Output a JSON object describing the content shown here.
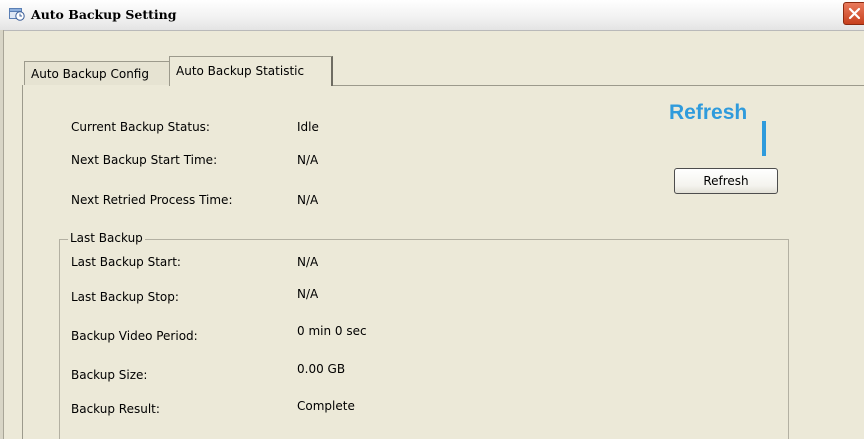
{
  "window": {
    "title": "Auto Backup Setting",
    "icon": "clock-icon"
  },
  "tabs": [
    {
      "label": "Auto Backup Config",
      "active": false
    },
    {
      "label": "Auto Backup Statistic",
      "active": true
    }
  ],
  "status": {
    "current_label": "Current Backup Status:",
    "current_value": "Idle",
    "next_start_label": "Next Backup Start Time:",
    "next_start_value": "N/A",
    "next_retried_label": "Next Retried Process Time:",
    "next_retried_value": "N/A"
  },
  "last_backup": {
    "group_label": "Last Backup",
    "start_label": "Last Backup Start:",
    "start_value": "N/A",
    "stop_label": "Last Backup Stop:",
    "stop_value": "N/A",
    "period_label": "Backup Video Period:",
    "period_value": "0 min 0 sec",
    "size_label": "Backup Size:",
    "size_value": "0.00 GB",
    "result_label": "Backup Result:",
    "result_value": "Complete"
  },
  "refresh_button_label": "Refresh",
  "annotation": {
    "text": "Refresh",
    "color": "#2f9bdc"
  }
}
